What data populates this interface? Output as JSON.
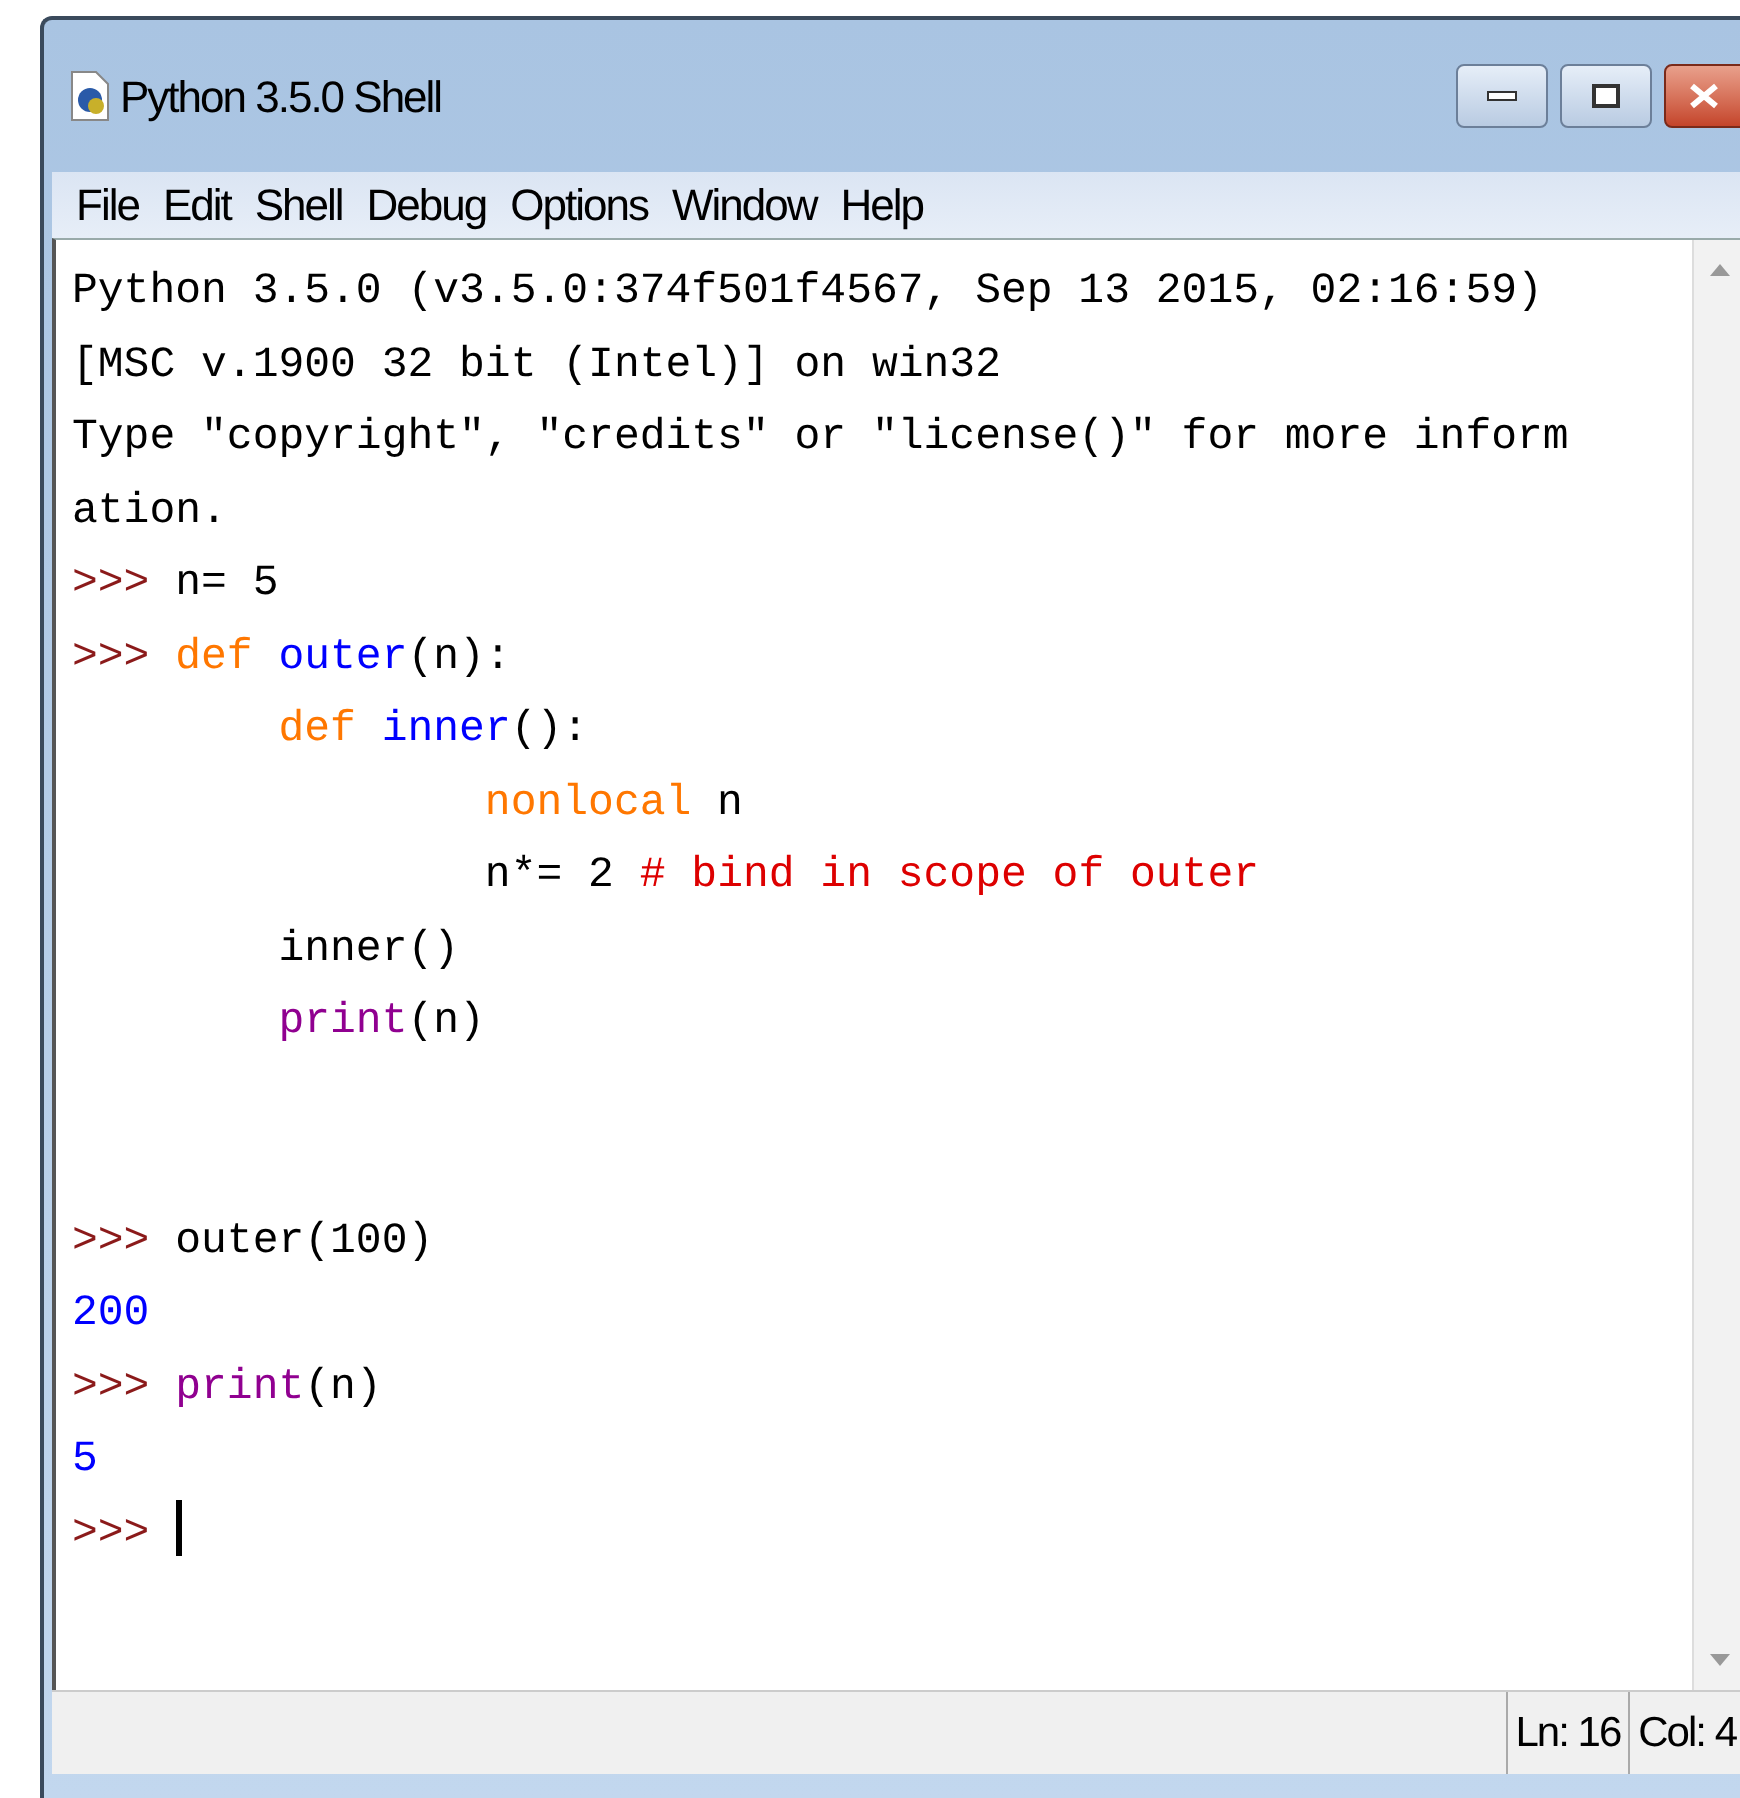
{
  "window": {
    "title": "Python 3.5.0 Shell"
  },
  "menu": [
    "File",
    "Edit",
    "Shell",
    "Debug",
    "Options",
    "Window",
    "Help"
  ],
  "lines": [
    {
      "kind": "text",
      "segments": [
        {
          "kind": "output",
          "text": "Python 3.5.0 (v3.5.0:374f501f4567, Sep 13 2015, 02:16:59)"
        }
      ]
    },
    {
      "kind": "text",
      "segments": [
        {
          "kind": "output",
          "text": "[MSC v.1900 32 bit (Intel)] on win32"
        }
      ]
    },
    {
      "kind": "text",
      "segments": [
        {
          "kind": "output",
          "text": "Type \"copyright\", \"credits\" or \"license()\" for more inform"
        }
      ]
    },
    {
      "kind": "text",
      "segments": [
        {
          "kind": "output",
          "text": "ation."
        }
      ]
    },
    {
      "kind": "text",
      "segments": [
        {
          "kind": "prompt",
          "text": ">>>"
        },
        {
          "kind": "plain",
          "text": " n= 5"
        }
      ]
    },
    {
      "kind": "text",
      "segments": [
        {
          "kind": "prompt",
          "text": ">>>"
        },
        {
          "kind": "keyword",
          "text": " def"
        },
        {
          "kind": "definition",
          "text": " outer"
        },
        {
          "kind": "plain",
          "text": "(n):"
        }
      ]
    },
    {
      "kind": "text",
      "segments": [
        {
          "kind": "keyword",
          "text": "        def"
        },
        {
          "kind": "definition",
          "text": " inner"
        },
        {
          "kind": "plain",
          "text": "():"
        }
      ]
    },
    {
      "kind": "text",
      "segments": [
        {
          "kind": "keyword",
          "text": "                nonlocal"
        },
        {
          "kind": "plain",
          "text": " n"
        }
      ]
    },
    {
      "kind": "text",
      "segments": [
        {
          "kind": "plain",
          "text": "                n*= 2 "
        },
        {
          "kind": "comment",
          "text": "# bind in scope of outer"
        }
      ]
    },
    {
      "kind": "text",
      "segments": [
        {
          "kind": "plain",
          "text": "        inner()"
        }
      ]
    },
    {
      "kind": "text",
      "segments": [
        {
          "kind": "builtin",
          "text": "        print"
        },
        {
          "kind": "plain",
          "text": "(n)"
        }
      ]
    },
    {
      "kind": "blank"
    },
    {
      "kind": "blank"
    },
    {
      "kind": "text",
      "segments": [
        {
          "kind": "prompt",
          "text": ">>>"
        },
        {
          "kind": "plain",
          "text": " outer(100)"
        }
      ]
    },
    {
      "kind": "text",
      "segments": [
        {
          "kind": "result",
          "text": "200"
        }
      ]
    },
    {
      "kind": "text",
      "segments": [
        {
          "kind": "prompt",
          "text": ">>>"
        },
        {
          "kind": "builtin",
          "text": " print"
        },
        {
          "kind": "plain",
          "text": "(n)"
        }
      ]
    },
    {
      "kind": "text",
      "segments": [
        {
          "kind": "result",
          "text": "5"
        }
      ]
    },
    {
      "kind": "input",
      "segments": [
        {
          "kind": "prompt",
          "text": ">>>"
        }
      ]
    }
  ],
  "status_bar": {
    "line": "Ln: 16",
    "column": "Col: 4"
  }
}
